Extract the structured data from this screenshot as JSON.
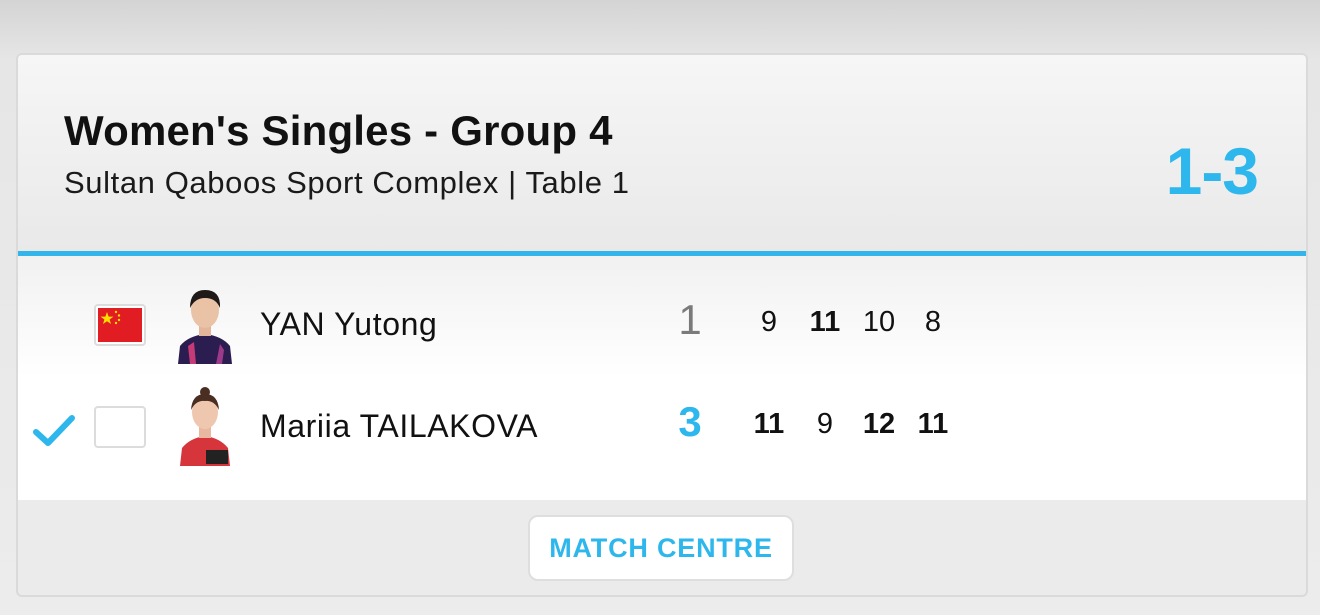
{
  "match": {
    "title": "Women's Singles - Group 4",
    "venue": "Sultan Qaboos Sport Complex | Table 1",
    "score": "1-3"
  },
  "players": [
    {
      "name": "YAN Yutong",
      "flag": "china-flag",
      "games_won": "1",
      "winner": false,
      "sets": [
        "9",
        "11",
        "10",
        "8"
      ]
    },
    {
      "name": "Mariia TAILAKOVA",
      "flag": "empty-flag",
      "games_won": "3",
      "winner": true,
      "sets": [
        "11",
        "9",
        "12",
        "11"
      ]
    }
  ],
  "footer": {
    "button_label": "MATCH CENTRE"
  },
  "colors": {
    "accent": "#2db7ec",
    "flag_red": "#e21c23",
    "star": "#ffde00"
  }
}
